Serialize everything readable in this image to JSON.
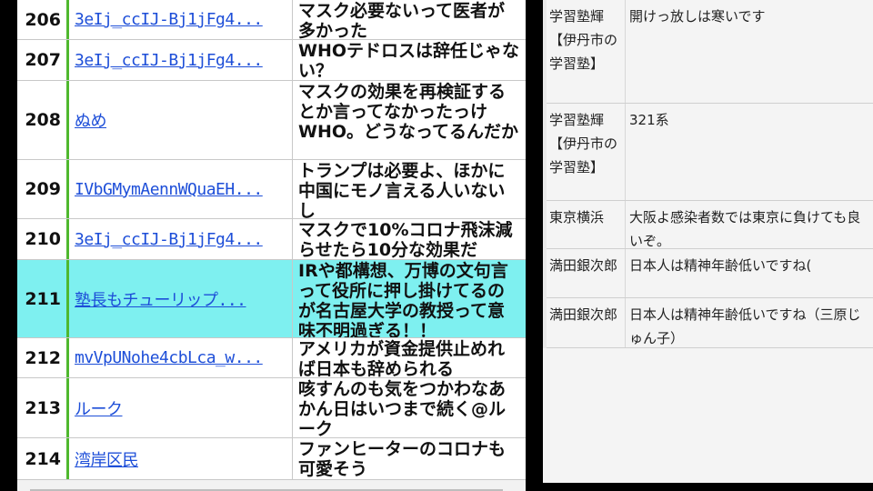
{
  "comments": [
    {
      "num": "206",
      "user": "3eIj_ccIJ-Bj1jFg4...",
      "text": "マスク必要ないって医者が多かった"
    },
    {
      "num": "207",
      "user": "3eIj_ccIJ-Bj1jFg4...",
      "text": "WHOテドロスは辞任じゃない？"
    },
    {
      "num": "208",
      "user": "ぬめ",
      "text": "マスクの効果を再検証するとか言ってなかったっけWHO。どうなってるんだか"
    },
    {
      "num": "209",
      "user": "IVbGMymAennWQuaEH...",
      "text": "トランプは必要よ、ほかに中国にモノ言える人いないし"
    },
    {
      "num": "210",
      "user": "3eIj_ccIJ-Bj1jFg4...",
      "text": "マスクで10%コロナ飛沫減らせたら10分な効果だ"
    },
    {
      "num": "211",
      "user": "塾長もチューリップ...",
      "text": "IRや都構想、万博の文句言って役所に押し掛けてるのが名古屋大学の教授って意味不明過ぎる！！"
    },
    {
      "num": "212",
      "user": "mvVpUNohe4cbLca_w...",
      "text": "アメリカが資金提供止めれば日本も辞められる"
    },
    {
      "num": "213",
      "user": "ルーク",
      "text": "咳すんのも気をつかわなあかん日はいつまで続く@ルーク"
    },
    {
      "num": "214",
      "user": "湾岸区民",
      "text": "ファンヒーターのコロナも可愛そう"
    }
  ],
  "chat": [
    {
      "name": "学習塾輝【伊丹市の学習塾】",
      "text": "開けっ放しは寒いです"
    },
    {
      "name": "学習塾輝【伊丹市の学習塾】",
      "text": "321系"
    },
    {
      "name": "東京横浜",
      "text": "大阪よ感染者数では東京に負けても良いぞ。"
    },
    {
      "name": "満田銀次郎",
      "text": "日本人は精神年齢低いですね("
    },
    {
      "name": "満田銀次郎",
      "text": "日本人は精神年齢低いですね（三原じゅん子）"
    }
  ],
  "colors": {
    "highlight": "#7ef0f0",
    "link": "#1d4ed8",
    "accent_bar": "#4fb82e"
  }
}
